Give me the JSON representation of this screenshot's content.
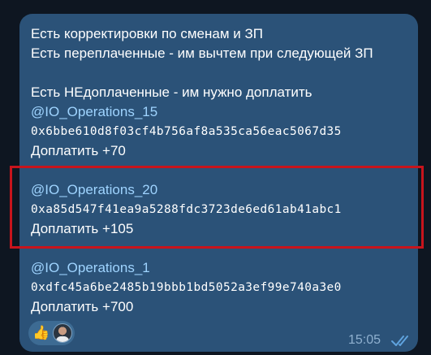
{
  "message": {
    "lines": [
      "Есть корректировки по сменам и ЗП",
      "Есть переплаченные - им вычтем при следующей ЗП",
      "Есть НЕдоплаченные - им нужно доплатить"
    ],
    "entries": [
      {
        "mention": "@IO_Operations_15",
        "address": "0x6bbe610d8f03cf4b756af8a535ca56eac5067d35",
        "payment": " Доплатить +70"
      },
      {
        "mention": "@IO_Operations_20",
        "address": "0xa85d547f41ea9a5288fdc3723de6ed61ab41abc1",
        "payment": "Доплатить +105"
      },
      {
        "mention": "@IO_Operations_1",
        "address": "0xdfc45a6be2485b19bbb1bd5052a3ef99e740a3e0",
        "payment": "Доплатить +700"
      }
    ],
    "reaction": {
      "emoji": "👍",
      "reactor_icon": "user-avatar"
    },
    "time": "15:05",
    "status_icon": "double-check-read-icon"
  },
  "colors": {
    "background": "#0e1621",
    "bubble": "#2b5278",
    "mention": "#9fd4ff",
    "highlight_border": "#c8141c",
    "time": "#8fb0cf",
    "checks": "#5fa3de"
  }
}
